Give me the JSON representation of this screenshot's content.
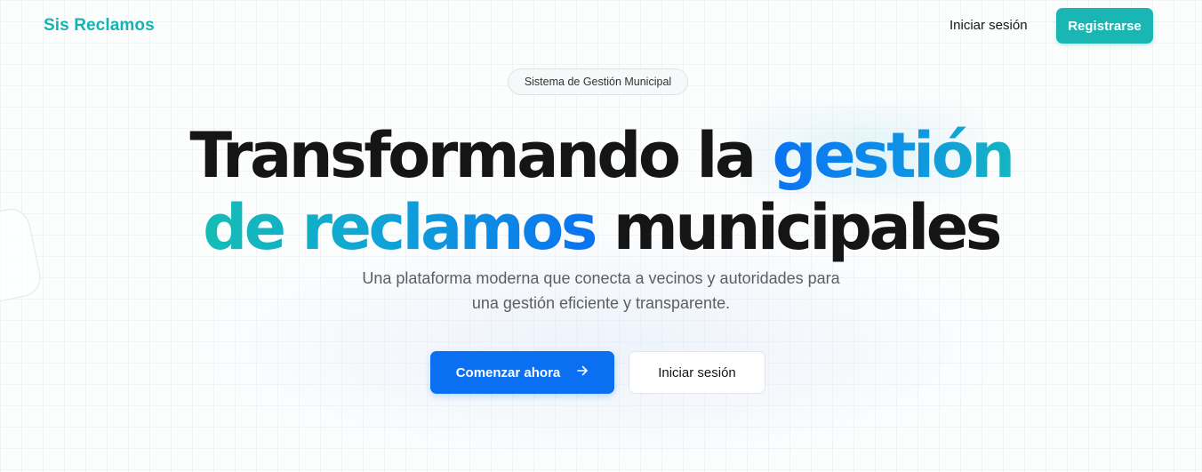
{
  "header": {
    "brand": "Sis Reclamos",
    "login_label": "Iniciar sesión",
    "register_label": "Registrarse"
  },
  "hero": {
    "badge": "Sistema de Gestión Municipal",
    "headline": {
      "line1_plain": "Transformando la",
      "line1_highlight": "gestión",
      "line2_highlight": "de reclamos",
      "line2_plain": "municipales"
    },
    "subtitle_line1": "Una plataforma moderna que conecta a vecinos y autoridades para",
    "subtitle_line2": "una gestión eficiente y transparente.",
    "primary_cta_label": "Comenzar ahora",
    "primary_cta_icon": "arrow-right-icon",
    "secondary_cta_label": "Iniciar sesión"
  },
  "colors": {
    "brand": "#17b3b3",
    "register_button": "#19b6b3",
    "primary_button": "#0a6ff1",
    "headline_dark": "#151515",
    "gradient_blue": "#0b72f2",
    "gradient_teal": "#15bdb4"
  }
}
